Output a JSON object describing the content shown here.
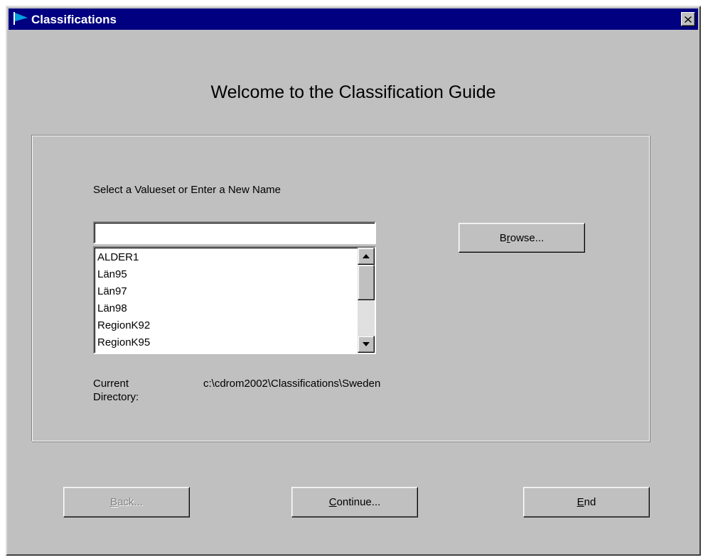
{
  "window": {
    "title": "Classifications",
    "close_label": "✕"
  },
  "heading": "Welcome to the Classification Guide",
  "valueset": {
    "prompt": "Select a Valueset or Enter a New Name",
    "input_value": "",
    "items": [
      "ALDER1",
      "Län95",
      "Län97",
      "Län98",
      "RegionK92",
      "RegionK95"
    ],
    "scroll_position": 0.15
  },
  "browse_button": {
    "prefix": "B",
    "accel": "r",
    "suffix": "owse..."
  },
  "current_directory": {
    "label_line1": "Current",
    "label_line2": "Directory:",
    "value": "c:\\cdrom2002\\Classifications\\Sweden"
  },
  "buttons": {
    "back": {
      "accel": "B",
      "rest": "ack...",
      "enabled": false
    },
    "continue": {
      "accel": "C",
      "rest": "ontinue...",
      "enabled": true
    },
    "end": {
      "accel": "E",
      "rest": "nd",
      "enabled": true
    }
  },
  "colors": {
    "titlebar": "#000080",
    "face": "#c0c0c0",
    "logo": "#00a0e0"
  }
}
